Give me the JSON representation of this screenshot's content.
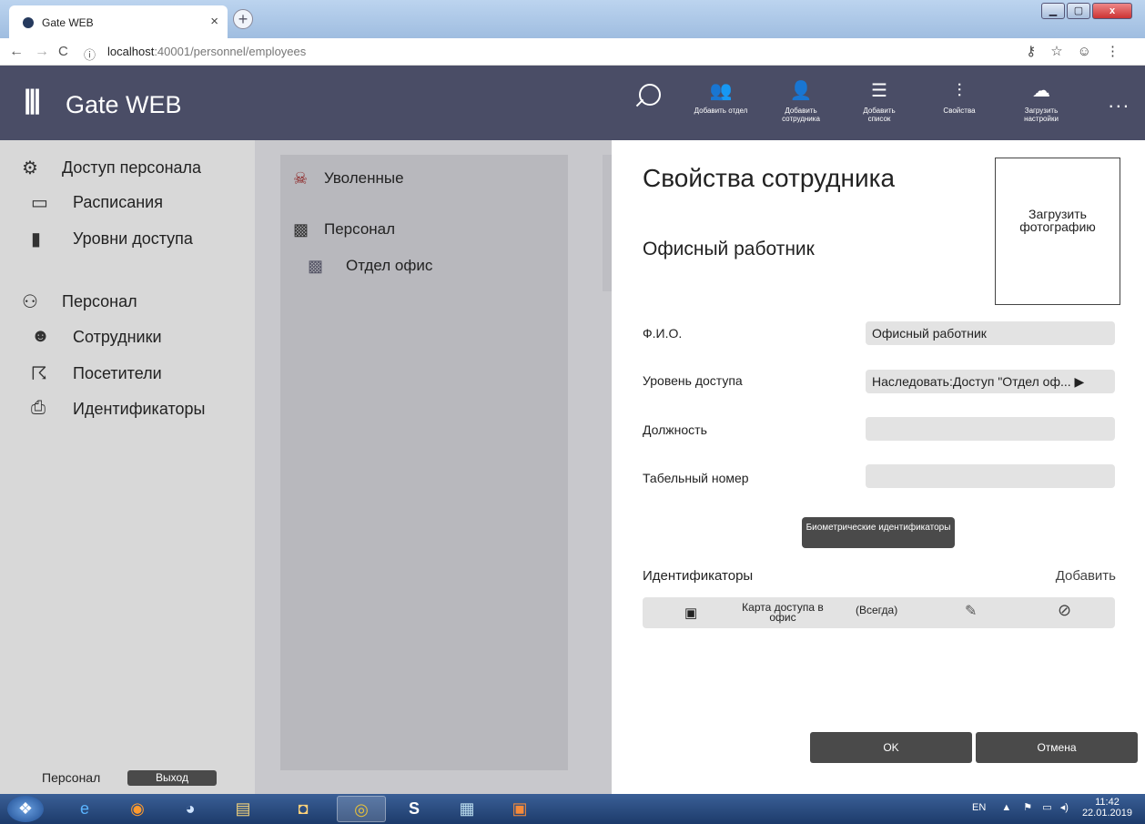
{
  "browser": {
    "tab_title": "Gate WEB",
    "tab_close": "×",
    "new_tab": "+",
    "url_host": "localhost",
    "url_rest": ":40001/personnel/employees"
  },
  "app": {
    "title": "Gate WEB",
    "toolbar": [
      {
        "icon": "add-department-icon",
        "glyph": "👥",
        "label": "Добавить отдел"
      },
      {
        "icon": "add-employee-icon",
        "glyph": "👤",
        "label": "Добавить сотрудника"
      },
      {
        "icon": "add-list-icon",
        "glyph": "☰",
        "label": "Добавить список"
      },
      {
        "icon": "properties-icon",
        "glyph": "⫶",
        "label": "Свойства"
      },
      {
        "icon": "upload-settings-icon",
        "glyph": "☁",
        "label": "Загрузить настройки"
      }
    ],
    "more": "..."
  },
  "sidebar": {
    "items": [
      {
        "label": "Доступ персонала",
        "icon": "gear-icon",
        "glyph": "⚙"
      },
      {
        "label": "Расписания",
        "icon": "calendar-icon",
        "glyph": "▭"
      },
      {
        "label": "Уровни доступа",
        "icon": "door-icon",
        "glyph": "▮"
      },
      {
        "label": "Персонал",
        "icon": "people-icon",
        "glyph": "⚇"
      },
      {
        "label": "Сотрудники",
        "icon": "employee-icon",
        "glyph": "☻"
      },
      {
        "label": "Посетители",
        "icon": "visitor-icon",
        "glyph": "☈"
      },
      {
        "label": "Идентификаторы",
        "icon": "card-reader-icon",
        "glyph": "⎙"
      }
    ],
    "footer_label": "Персонал",
    "logout_label": "Выход"
  },
  "tree": {
    "items": [
      {
        "label": "Уволенные",
        "icon": "fired-icon",
        "glyph": "☠"
      },
      {
        "label": "Персонал",
        "icon": "group-icon",
        "glyph": "▩"
      },
      {
        "label": "Отдел офис",
        "icon": "department-icon",
        "glyph": "▩"
      }
    ]
  },
  "panel": {
    "title": "Свойства сотрудника",
    "subtitle": "Офисный работник",
    "photo_label": "Загрузить фотографию",
    "fields": [
      {
        "label": "Ф.И.О.",
        "value": "Офисный работник"
      },
      {
        "label": "Уровень доступа",
        "value": "Наследовать:Доступ \"Отдел оф... ▶"
      },
      {
        "label": "Должность",
        "value": ""
      },
      {
        "label": "Табельный номер",
        "value": ""
      }
    ],
    "bio_button": "Биометрические идентификаторы",
    "identifiers_label": "Идентификаторы",
    "add_label": "Добавить",
    "identifier_row": {
      "name": "Карта доступа в офис",
      "period": "(Всегда)"
    },
    "ok_label": "OK",
    "cancel_label": "Отмена"
  },
  "taskbar": {
    "lang": "EN",
    "time": "11:42",
    "date": "22.01.2019"
  }
}
